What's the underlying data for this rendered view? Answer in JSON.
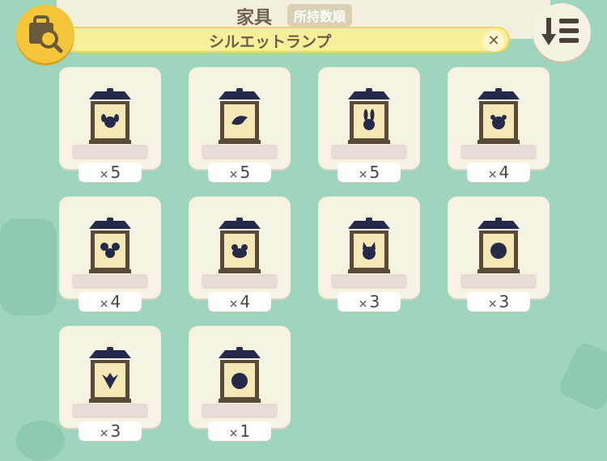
{
  "header": {
    "title": "家具",
    "sort_label": "所持数順",
    "search_query": "シルエットランプ",
    "clear_symbol": "✕"
  },
  "icons": {
    "search_button": "bag-search-icon",
    "sort_button": "sort-descending-icon"
  },
  "colors": {
    "background": "#9fd4bd",
    "search_bar": "#f8ef9a",
    "search_button": "#f5c53a",
    "lamp_roof": "#262a4a",
    "lamp_panel": "#f6e8b6"
  },
  "items": [
    {
      "silhouette": "dog-face",
      "count": "5"
    },
    {
      "silhouette": "bird",
      "count": "5"
    },
    {
      "silhouette": "rabbit-face",
      "count": "5"
    },
    {
      "silhouette": "bear-face",
      "count": "4"
    },
    {
      "silhouette": "mouse-face",
      "count": "4"
    },
    {
      "silhouette": "frog-face",
      "count": "4"
    },
    {
      "silhouette": "cat-face",
      "count": "3"
    },
    {
      "silhouette": "sheep-face",
      "count": "3"
    },
    {
      "silhouette": "wolf-face",
      "count": "3"
    },
    {
      "silhouette": "gorilla-face",
      "count": "1"
    }
  ]
}
